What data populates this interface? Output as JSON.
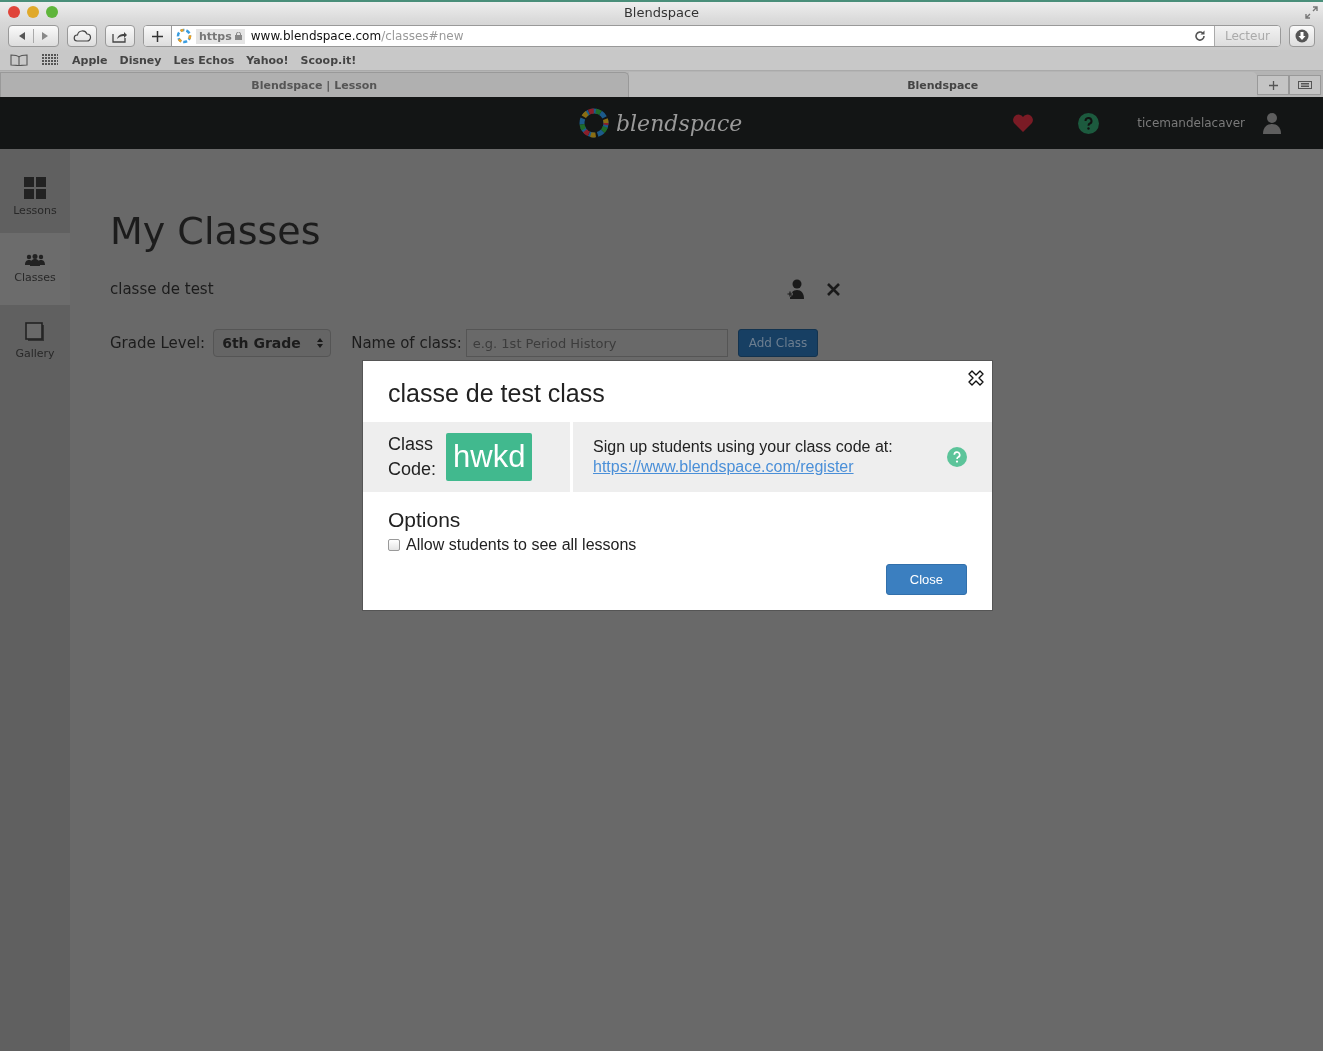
{
  "window": {
    "title": "Blendspace"
  },
  "toolbar": {
    "url_scheme": "https",
    "url_host": "www.blendspace.com",
    "url_path": "/classes#new",
    "reader_button": "Lecteur"
  },
  "bookmarks": [
    "Apple",
    "Disney",
    "Les Echos",
    "Yahoo!",
    "Scoop.it!"
  ],
  "tabs": [
    {
      "label": "Blendspace | Lesson",
      "selected": false
    },
    {
      "label": "Blendspace",
      "selected": true
    }
  ],
  "header": {
    "logo": "blendspace",
    "username": "ticemandelacaver"
  },
  "sidebar": {
    "items": [
      {
        "label": "Lessons",
        "kind": "grid",
        "selected": false
      },
      {
        "label": "Classes",
        "kind": "people",
        "selected": true
      },
      {
        "label": "Gallery",
        "kind": "gallery",
        "selected": false
      }
    ]
  },
  "page": {
    "title": "My Classes",
    "class_name": "classe de test",
    "grade_label": "Grade Level:",
    "grade_value": "6th Grade",
    "name_label": "Name of class:",
    "name_placeholder": "e.g. 1st Period History",
    "add_button": "Add Class"
  },
  "modal": {
    "title": "classe de test class",
    "code_label_1": "Class",
    "code_label_2": "Code:",
    "code": "hwkd",
    "signup_text": "Sign up students using your class code at:",
    "signup_link": "https://www.blendspace.com/register",
    "options_title": "Options",
    "options": [
      {
        "label": "Allow students to see all lessons",
        "checked": false
      }
    ],
    "close_button": "Close"
  }
}
